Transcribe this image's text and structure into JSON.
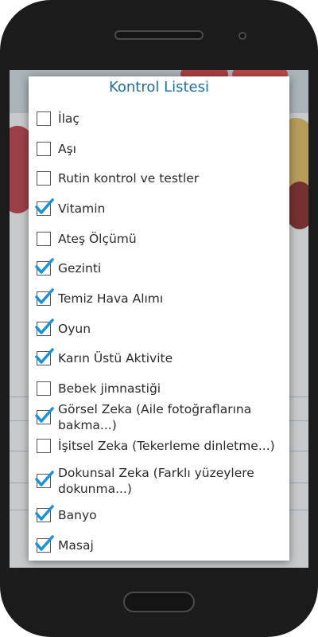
{
  "dialog": {
    "title": "Kontrol Listesi",
    "items": [
      {
        "label": "İlaç",
        "checked": false
      },
      {
        "label": "Aşı",
        "checked": false
      },
      {
        "label": "Rutin kontrol ve testler",
        "checked": false
      },
      {
        "label": "Vitamin",
        "checked": true
      },
      {
        "label": "Ateş Ölçümü",
        "checked": false
      },
      {
        "label": "Gezinti",
        "checked": true
      },
      {
        "label": "Temiz Hava Alımı",
        "checked": true
      },
      {
        "label": "Oyun",
        "checked": true
      },
      {
        "label": "Karın Üstü Aktivite",
        "checked": true
      },
      {
        "label": "Bebek jimnastiği",
        "checked": false
      },
      {
        "label": "Görsel Zeka (Aile fotoğraflarına bakma...)",
        "checked": true
      },
      {
        "label": "İşitsel Zeka (Tekerleme dinletme...)",
        "checked": false
      },
      {
        "label": "Dokunsal Zeka (Farklı yüzeylere dokunma...)",
        "checked": true
      },
      {
        "label": "Banyo",
        "checked": true
      },
      {
        "label": "Masaj",
        "checked": true
      }
    ]
  },
  "colors": {
    "checkmark": "#1a93d6",
    "title": "#1f6fa0"
  },
  "icons": {
    "check": "check-icon"
  }
}
